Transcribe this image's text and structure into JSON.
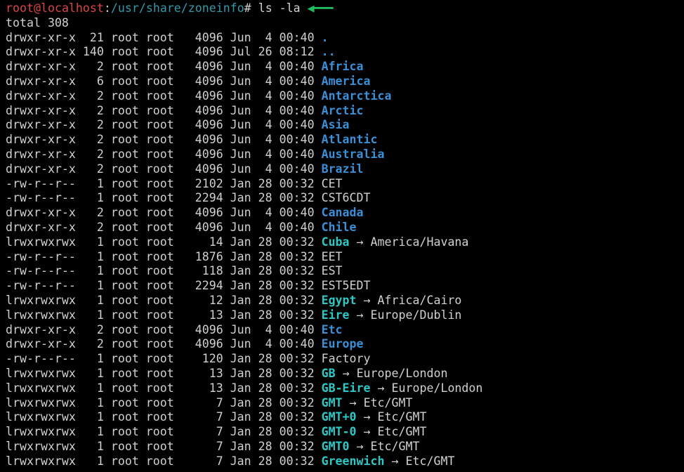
{
  "prompt": {
    "user": "root",
    "host": "localhost",
    "path": "/usr/share/zoneinfo",
    "symbol": "#",
    "command": "ls -la"
  },
  "annotation_arrow": "◀━━━",
  "total_line": "total 308",
  "columns": {},
  "entries": [
    {
      "perm": "drwxr-xr-x",
      "links": "21",
      "owner": "root",
      "group": "root",
      "size": "4096",
      "date": "Jun  4 00:40",
      "name": ".",
      "type": "dir"
    },
    {
      "perm": "drwxr-xr-x",
      "links": "140",
      "owner": "root",
      "group": "root",
      "size": "4096",
      "date": "Jul 26 08:12",
      "name": "..",
      "type": "dir"
    },
    {
      "perm": "drwxr-xr-x",
      "links": "2",
      "owner": "root",
      "group": "root",
      "size": "4096",
      "date": "Jun  4 00:40",
      "name": "Africa",
      "type": "dir"
    },
    {
      "perm": "drwxr-xr-x",
      "links": "6",
      "owner": "root",
      "group": "root",
      "size": "4096",
      "date": "Jun  4 00:40",
      "name": "America",
      "type": "dir"
    },
    {
      "perm": "drwxr-xr-x",
      "links": "2",
      "owner": "root",
      "group": "root",
      "size": "4096",
      "date": "Jun  4 00:40",
      "name": "Antarctica",
      "type": "dir"
    },
    {
      "perm": "drwxr-xr-x",
      "links": "2",
      "owner": "root",
      "group": "root",
      "size": "4096",
      "date": "Jun  4 00:40",
      "name": "Arctic",
      "type": "dir"
    },
    {
      "perm": "drwxr-xr-x",
      "links": "2",
      "owner": "root",
      "group": "root",
      "size": "4096",
      "date": "Jun  4 00:40",
      "name": "Asia",
      "type": "dir"
    },
    {
      "perm": "drwxr-xr-x",
      "links": "2",
      "owner": "root",
      "group": "root",
      "size": "4096",
      "date": "Jun  4 00:40",
      "name": "Atlantic",
      "type": "dir"
    },
    {
      "perm": "drwxr-xr-x",
      "links": "2",
      "owner": "root",
      "group": "root",
      "size": "4096",
      "date": "Jun  4 00:40",
      "name": "Australia",
      "type": "dir"
    },
    {
      "perm": "drwxr-xr-x",
      "links": "2",
      "owner": "root",
      "group": "root",
      "size": "4096",
      "date": "Jun  4 00:40",
      "name": "Brazil",
      "type": "dir"
    },
    {
      "perm": "-rw-r--r--",
      "links": "1",
      "owner": "root",
      "group": "root",
      "size": "2102",
      "date": "Jan 28 00:32",
      "name": "CET",
      "type": "file"
    },
    {
      "perm": "-rw-r--r--",
      "links": "1",
      "owner": "root",
      "group": "root",
      "size": "2294",
      "date": "Jan 28 00:32",
      "name": "CST6CDT",
      "type": "file"
    },
    {
      "perm": "drwxr-xr-x",
      "links": "2",
      "owner": "root",
      "group": "root",
      "size": "4096",
      "date": "Jun  4 00:40",
      "name": "Canada",
      "type": "dir"
    },
    {
      "perm": "drwxr-xr-x",
      "links": "2",
      "owner": "root",
      "group": "root",
      "size": "4096",
      "date": "Jun  4 00:40",
      "name": "Chile",
      "type": "dir"
    },
    {
      "perm": "lrwxrwxrwx",
      "links": "1",
      "owner": "root",
      "group": "root",
      "size": "14",
      "date": "Jan 28 00:32",
      "name": "Cuba",
      "type": "link",
      "target": "America/Havana"
    },
    {
      "perm": "-rw-r--r--",
      "links": "1",
      "owner": "root",
      "group": "root",
      "size": "1876",
      "date": "Jan 28 00:32",
      "name": "EET",
      "type": "file"
    },
    {
      "perm": "-rw-r--r--",
      "links": "1",
      "owner": "root",
      "group": "root",
      "size": "118",
      "date": "Jan 28 00:32",
      "name": "EST",
      "type": "file"
    },
    {
      "perm": "-rw-r--r--",
      "links": "1",
      "owner": "root",
      "group": "root",
      "size": "2294",
      "date": "Jan 28 00:32",
      "name": "EST5EDT",
      "type": "file"
    },
    {
      "perm": "lrwxrwxrwx",
      "links": "1",
      "owner": "root",
      "group": "root",
      "size": "12",
      "date": "Jan 28 00:32",
      "name": "Egypt",
      "type": "link",
      "target": "Africa/Cairo"
    },
    {
      "perm": "lrwxrwxrwx",
      "links": "1",
      "owner": "root",
      "group": "root",
      "size": "13",
      "date": "Jan 28 00:32",
      "name": "Eire",
      "type": "link",
      "target": "Europe/Dublin"
    },
    {
      "perm": "drwxr-xr-x",
      "links": "2",
      "owner": "root",
      "group": "root",
      "size": "4096",
      "date": "Jun  4 00:40",
      "name": "Etc",
      "type": "dir"
    },
    {
      "perm": "drwxr-xr-x",
      "links": "2",
      "owner": "root",
      "group": "root",
      "size": "4096",
      "date": "Jun  4 00:40",
      "name": "Europe",
      "type": "dir"
    },
    {
      "perm": "-rw-r--r--",
      "links": "1",
      "owner": "root",
      "group": "root",
      "size": "120",
      "date": "Jan 28 00:32",
      "name": "Factory",
      "type": "file"
    },
    {
      "perm": "lrwxrwxrwx",
      "links": "1",
      "owner": "root",
      "group": "root",
      "size": "13",
      "date": "Jan 28 00:32",
      "name": "GB",
      "type": "link",
      "target": "Europe/London"
    },
    {
      "perm": "lrwxrwxrwx",
      "links": "1",
      "owner": "root",
      "group": "root",
      "size": "13",
      "date": "Jan 28 00:32",
      "name": "GB-Eire",
      "type": "link",
      "target": "Europe/London"
    },
    {
      "perm": "lrwxrwxrwx",
      "links": "1",
      "owner": "root",
      "group": "root",
      "size": "7",
      "date": "Jan 28 00:32",
      "name": "GMT",
      "type": "link",
      "target": "Etc/GMT"
    },
    {
      "perm": "lrwxrwxrwx",
      "links": "1",
      "owner": "root",
      "group": "root",
      "size": "7",
      "date": "Jan 28 00:32",
      "name": "GMT+0",
      "type": "link",
      "target": "Etc/GMT"
    },
    {
      "perm": "lrwxrwxrwx",
      "links": "1",
      "owner": "root",
      "group": "root",
      "size": "7",
      "date": "Jan 28 00:32",
      "name": "GMT-0",
      "type": "link",
      "target": "Etc/GMT"
    },
    {
      "perm": "lrwxrwxrwx",
      "links": "1",
      "owner": "root",
      "group": "root",
      "size": "7",
      "date": "Jan 28 00:32",
      "name": "GMT0",
      "type": "link",
      "target": "Etc/GMT"
    },
    {
      "perm": "lrwxrwxrwx",
      "links": "1",
      "owner": "root",
      "group": "root",
      "size": "7",
      "date": "Jan 28 00:32",
      "name": "Greenwich",
      "type": "link",
      "target": "Etc/GMT"
    }
  ],
  "link_arrow": "→"
}
